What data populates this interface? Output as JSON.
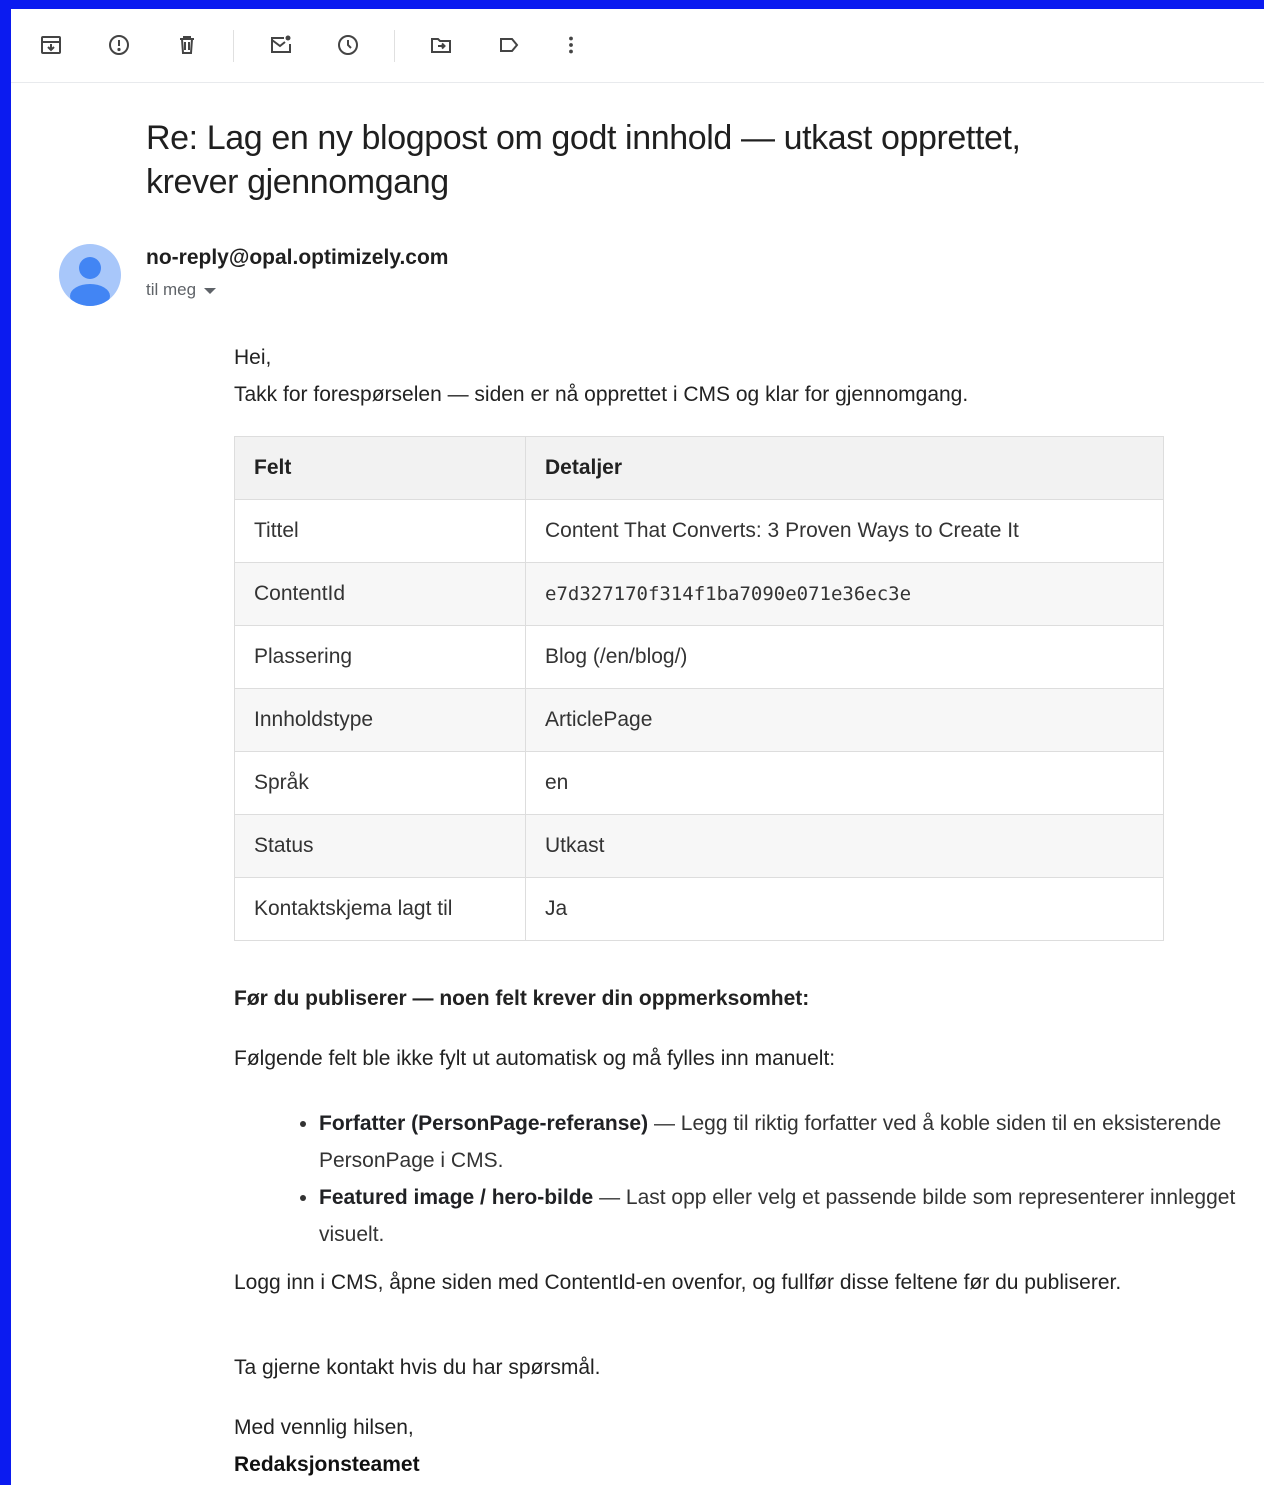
{
  "toolbar": {
    "icons": [
      "archive-icon",
      "report-spam-icon",
      "delete-icon",
      "mark-unread-icon",
      "snooze-icon",
      "move-to-icon",
      "label-icon",
      "more-vert-icon"
    ]
  },
  "email": {
    "subject": "Re: Lag en ny blogpost om godt innhold — utkast opprettet, krever gjennomgang",
    "sender": "no-reply@opal.optimizely.com",
    "recipient": "til meg",
    "greeting": "Hei,",
    "intro": "Takk for forespørselen — siden er nå opprettet i CMS og klar for gjennomgang.",
    "table": {
      "headers": [
        "Felt",
        "Detaljer"
      ],
      "rows": [
        {
          "field": "Tittel",
          "value": "Content That Converts: 3 Proven Ways to Create It"
        },
        {
          "field": "ContentId",
          "value": "e7d327170f314f1ba7090e071e36ec3e"
        },
        {
          "field": "Plassering",
          "value": "Blog (/en/blog/)"
        },
        {
          "field": "Innholdstype",
          "value": "ArticlePage"
        },
        {
          "field": "Språk",
          "value": "en"
        },
        {
          "field": "Status",
          "value": "Utkast"
        },
        {
          "field": "Kontaktskjema lagt til",
          "value": "Ja"
        }
      ]
    },
    "attention_heading": "Før du publiserer — noen felt krever din oppmerksomhet:",
    "attention_intro": "Følgende felt ble ikke fylt ut automatisk og må fylles inn manuelt:",
    "missing_fields": [
      {
        "name": "Forfatter (PersonPage-referanse)",
        "text": " — Legg til riktig forfatter ved å koble siden til en eksisterende PersonPage i CMS."
      },
      {
        "name": "Featured image / hero-bilde",
        "text": " — Last opp eller velg et passende bilde som representerer innlegget visuelt."
      }
    ],
    "login_text": "Logg inn i CMS, åpne siden med ContentId-en ovenfor, og fullfør disse feltene før du publiserer.",
    "contact_text": "Ta gjerne kontakt hvis du har spørsmål.",
    "closing": "Med vennlig hilsen,",
    "team": "Redaksjonsteamet"
  },
  "colors": {
    "frame_border": "#0b1bf0",
    "avatar": "#a8c7fa",
    "avatar_figure": "#4285f4"
  }
}
